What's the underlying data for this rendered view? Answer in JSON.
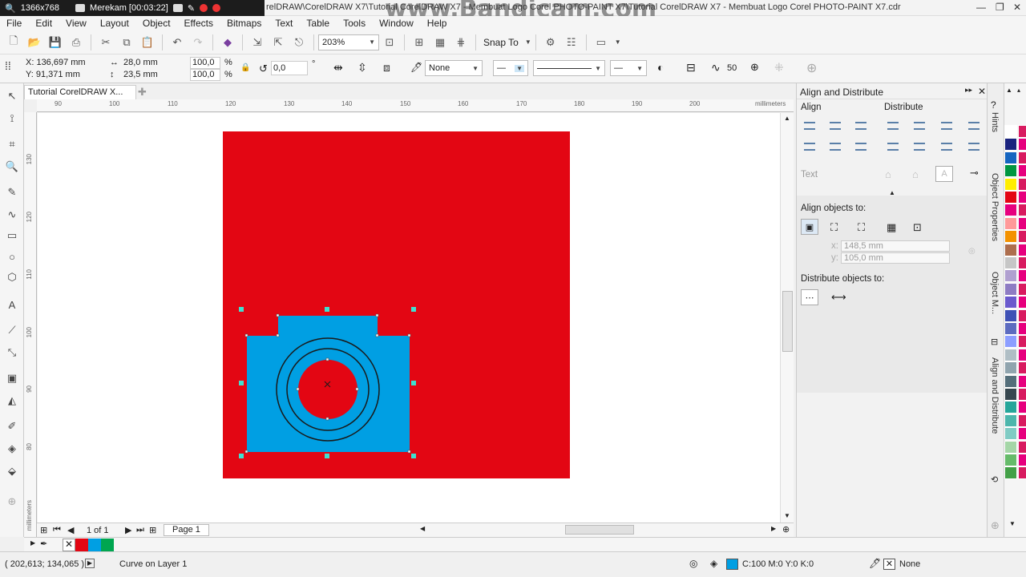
{
  "recorder": {
    "resolution": "1366x768",
    "status": "Merekam [00:03:22]"
  },
  "title": "relDRAW\\CorelDRAW X7\\Tutorial CorelDRAW X7 - Membuat Logo Corel PHOTO-PAINT X7\\Tutorial CorelDRAW X7 - Membuat Logo Corel PHOTO-PAINT X7.cdr",
  "watermark": "www.Bandicam.com",
  "menu": [
    "File",
    "Edit",
    "View",
    "Layout",
    "Object",
    "Effects",
    "Bitmaps",
    "Text",
    "Table",
    "Tools",
    "Window",
    "Help"
  ],
  "toolbar": {
    "zoom": "203%",
    "snap_to": "Snap To"
  },
  "props": {
    "x": "X: 136,697 mm",
    "y": "Y: 91,371 mm",
    "width": "28,0 mm",
    "height": "23,5 mm",
    "scale_w": "100,0",
    "scale_h": "100,0",
    "pct": "%",
    "angle": "0,0",
    "deg": "°",
    "fill_none": "None",
    "smooth": "50"
  },
  "document": {
    "tab": "Tutorial CorelDRAW X...",
    "ruler_unit": "millimeters",
    "ruler_h": [
      "90",
      "100",
      "110",
      "120",
      "130",
      "140",
      "150",
      "160",
      "170",
      "180",
      "190",
      "200"
    ],
    "ruler_v": [
      "130",
      "120",
      "110",
      "100",
      "90",
      "80"
    ],
    "page_count": "1 of 1",
    "page_tab": "Page 1"
  },
  "docker": {
    "title": "Align and Distribute",
    "align": "Align",
    "distribute": "Distribute",
    "text": "Text",
    "align_objects_to": "Align objects to:",
    "x_val": "148,5 mm",
    "y_val": "105,0 mm",
    "x_lab": "x:",
    "y_lab": "y:",
    "distribute_objects_to": "Distribute objects to:"
  },
  "vtabs": [
    "Hints",
    "Object Properties",
    "Object M...",
    "Align and Distribute"
  ],
  "status": {
    "coords": "( 202,613; 134,065 )",
    "object": "Curve on Layer 1",
    "fill": "C:100 M:0 Y:0 K:0",
    "outline": "None"
  },
  "colors": {
    "red": "#e30613",
    "blue": "#009fe3",
    "handle": "#40e0d0"
  },
  "palette": [
    "#ffffff",
    "#1a237e",
    "#1565c0",
    "#009640",
    "#ffed00",
    "#e30613",
    "#e6007e",
    "#ff9999",
    "#f39200",
    "#ad6e4e",
    "#c6c6c6",
    "#b0a0d0",
    "#8e7cc3",
    "#6a5acd",
    "#3f51b5",
    "#5c6bc0",
    "#8c9eff",
    "#b0bec5",
    "#90a4ae",
    "#546e7a",
    "#37474f",
    "#26a69a",
    "#4db6ac",
    "#80cbc4",
    "#a5d6a7",
    "#66bb6a",
    "#43a047"
  ]
}
